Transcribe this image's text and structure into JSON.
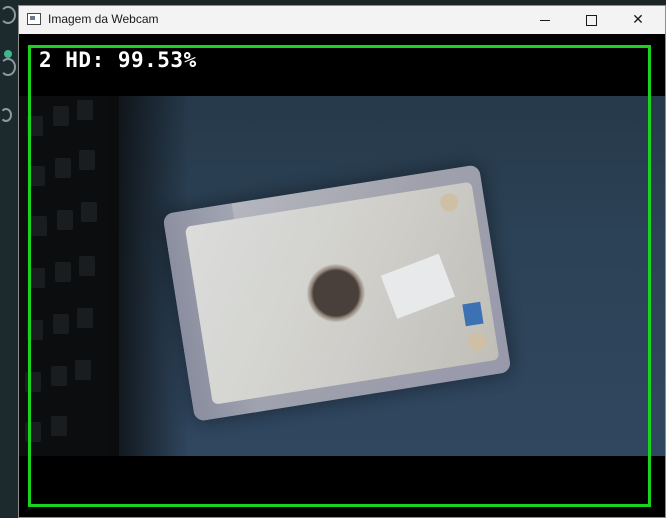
{
  "window": {
    "title": "Imagem da Webcam"
  },
  "controls": {
    "minimize_icon": "minimize-icon",
    "maximize_icon": "maximize-icon",
    "close_icon": "close-icon",
    "close_glyph": "✕"
  },
  "detection": {
    "label": "2 HD: 99.53%",
    "box_color": "#19d41d",
    "text_color": "#ffffff"
  }
}
